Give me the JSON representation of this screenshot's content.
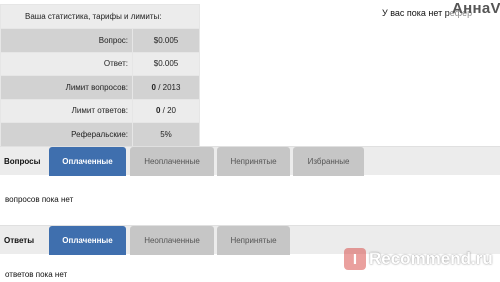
{
  "stats": {
    "title": "Ваша статистика, тарифы и лимиты:",
    "rows": [
      {
        "label": "Вопрос:",
        "value": "$0.005",
        "value_bold": "",
        "value_rest": ""
      },
      {
        "label": "Ответ:",
        "value": "$0.005",
        "value_bold": "",
        "value_rest": ""
      },
      {
        "label": "Лимит вопросов:",
        "value": "",
        "value_bold": "0",
        "value_rest": " / 2013"
      },
      {
        "label": "Лимит ответов:",
        "value": "",
        "value_bold": "0",
        "value_rest": " / 20"
      },
      {
        "label": "Реферальские:",
        "value": "5%",
        "value_bold": "",
        "value_rest": ""
      }
    ]
  },
  "header": {
    "notice": "У вас пока нет р",
    "notice_faded": "ефер",
    "username": "АннаV"
  },
  "questions": {
    "title": "Вопросы",
    "tabs": [
      "Оплаченные",
      "Неоплаченные",
      "Непринятые",
      "Избранные"
    ],
    "active_tab": 0,
    "empty_text": "вопросов пока нет"
  },
  "answers": {
    "title": "Ответы",
    "tabs": [
      "Оплаченные",
      "Неоплаченные",
      "Непринятые"
    ],
    "active_tab": 0,
    "empty_text": "ответов пока нет"
  },
  "watermark": {
    "logo": "I",
    "text": "Recommend.ru"
  },
  "colors": {
    "active_tab": "#3f6fae",
    "inactive_tab": "#c6c6c6",
    "bar": "#ececec"
  }
}
